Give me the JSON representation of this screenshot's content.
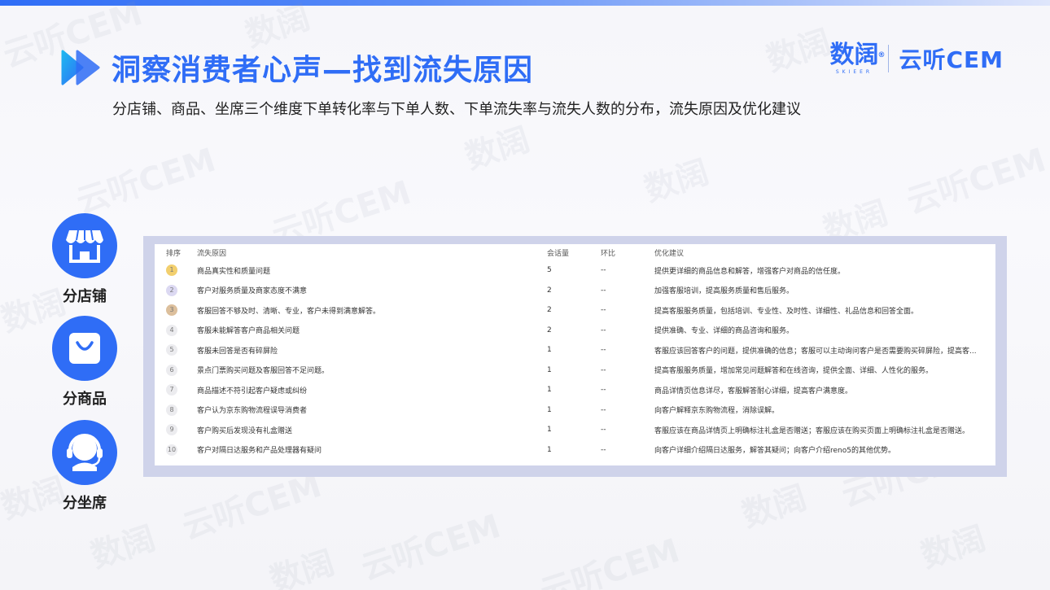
{
  "header": {
    "title": "洞察消费者心声—找到流失原因",
    "subtitle": "分店铺、商品、坐席三个维度下单转化率与下单人数、下单流失率与流失人数的分布，流失原因及优化建议",
    "brand_primary": "数阔",
    "brand_primary_sub": "SKIEER",
    "brand_secondary": "云听CEM",
    "accent_color": "#2f6df6"
  },
  "watermark": {
    "text_a": "数阔",
    "text_b": "云听CEM"
  },
  "categories": [
    {
      "label": "分店铺",
      "icon": "store-icon"
    },
    {
      "label": "分商品",
      "icon": "shopping-bag-icon"
    },
    {
      "label": "分坐席",
      "icon": "headset-agent-icon"
    }
  ],
  "table": {
    "columns": [
      "排序",
      "流失原因",
      "会话量",
      "环比",
      "优化建议"
    ],
    "rows": [
      {
        "rank": "1",
        "reason": "商品真实性和质量问题",
        "count": "5",
        "mom": "--",
        "advice": "提供更详细的商品信息和解答，增强客户对商品的信任度。",
        "badge": "#f2cf6e"
      },
      {
        "rank": "2",
        "reason": "客户对服务质量及商家态度不满意",
        "count": "2",
        "mom": "--",
        "advice": "加强客服培训，提高服务质量和售后服务。",
        "badge": "#dcd9f2"
      },
      {
        "rank": "3",
        "reason": "客服回答不够及时、清晰、专业，客户未得到满意解答。",
        "count": "2",
        "mom": "--",
        "advice": "提高客服服务质量，包括培训、专业性、及时性、详细性、礼品信息和回答全面。",
        "badge": "#dcbf9c"
      },
      {
        "rank": "4",
        "reason": "客服未能解答客户商品相关问题",
        "count": "2",
        "mom": "--",
        "advice": "提供准确、专业、详细的商品咨询和服务。",
        "badge": "#ececef"
      },
      {
        "rank": "5",
        "reason": "客服未回答是否有碎屏险",
        "count": "1",
        "mom": "--",
        "advice": "客服应该回答客户的问题，提供准确的信息；客服可以主动询问客户是否需要购买碎屏险，提高客...",
        "badge": "#ececef"
      },
      {
        "rank": "6",
        "reason": "景点门票购买问题及客服回答不足问题。",
        "count": "1",
        "mom": "--",
        "advice": "提高客服服务质量，增加常见问题解答和在线咨询，提供全面、详细、人性化的服务。",
        "badge": "#ececef"
      },
      {
        "rank": "7",
        "reason": "商品描述不符引起客户疑虑或纠纷",
        "count": "1",
        "mom": "--",
        "advice": "商品详情页信息详尽，客服解答耐心详细，提高客户满意度。",
        "badge": "#ececef"
      },
      {
        "rank": "8",
        "reason": "客户认为京东购物流程误导消费者",
        "count": "1",
        "mom": "--",
        "advice": "向客户解释京东购物流程，消除误解。",
        "badge": "#ececef"
      },
      {
        "rank": "9",
        "reason": "客户购买后发现没有礼盒赠送",
        "count": "1",
        "mom": "--",
        "advice": "客服应该在商品详情页上明确标注礼盒是否赠送；客服应该在购买页面上明确标注礼盒是否赠送。",
        "badge": "#ececef"
      },
      {
        "rank": "10",
        "reason": "客户对隔日达服务和产品处理器有疑问",
        "count": "1",
        "mom": "--",
        "advice": "向客户详细介绍隔日达服务，解答其疑问；向客户介绍reno5的其他优势。",
        "badge": "#ececef"
      }
    ]
  }
}
